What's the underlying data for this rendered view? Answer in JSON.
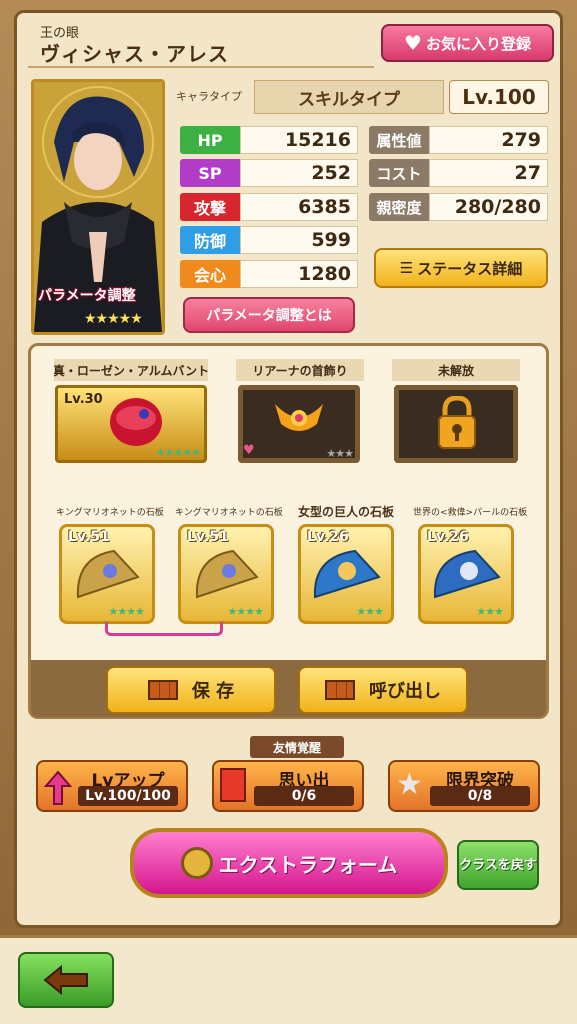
{
  "header": {
    "subtitle": "王の眼",
    "title": "ヴィシャス・アレス",
    "favorite_label": "お気に入り登録"
  },
  "character": {
    "type_label": "キャラタイプ",
    "type_value": "スキルタイプ",
    "level": "Lv.100",
    "param_label": "パラメータ調整",
    "stars": "★★★★★"
  },
  "stats_left": [
    {
      "label": "HP",
      "value": "15216",
      "color": "#3cb043"
    },
    {
      "label": "SP",
      "value": "252",
      "color": "#b03cc8"
    },
    {
      "label": "攻撃",
      "value": "6385",
      "color": "#d8262e"
    },
    {
      "label": "防御",
      "value": "599",
      "color": "#2f9ee6"
    },
    {
      "label": "会心",
      "value": "1280",
      "color": "#ef8a1c"
    }
  ],
  "stats_right": [
    {
      "label": "属性値",
      "value": "279"
    },
    {
      "label": "コスト",
      "value": "27"
    },
    {
      "label": "親密度",
      "value": "280/280"
    }
  ],
  "buttons": {
    "status_detail": "ステータス詳細",
    "param_about": "パラメータ調整とは",
    "save": "保 存",
    "call": "呼び出し",
    "extra_form": "エクストラフォーム",
    "class_back": "クラスを戻す"
  },
  "equipment": [
    {
      "title": "真・ローゼン・アルムバント",
      "level": "Lv.30",
      "stars": "★★★★★"
    },
    {
      "title": "リアーナの首飾り",
      "stars": "★★★"
    },
    {
      "title": "未解放"
    }
  ],
  "fragments": [
    {
      "title": "キングマリオネットの石板",
      "level": "Lv.51",
      "stars": "★★★★"
    },
    {
      "title": "キングマリオネットの石板",
      "level": "Lv.51",
      "stars": "★★★★"
    },
    {
      "title": "女型の巨人の石板",
      "level": "Lv.26",
      "stars": "★★★"
    },
    {
      "title": "世界の<救偉>パールの石板",
      "level": "Lv.26",
      "stars": "★★★"
    }
  ],
  "bottom": {
    "lvup_label": "Lvアップ",
    "lvup_value": "Lv.100/100",
    "yujo_label": "友情覚醒",
    "memory_label": "思い出",
    "memory_value": "0/6",
    "limit_label": "限界突破",
    "limit_value": "0/8"
  },
  "icons": {
    "back": "arrow-left-icon",
    "favorite": "heart-icon"
  }
}
